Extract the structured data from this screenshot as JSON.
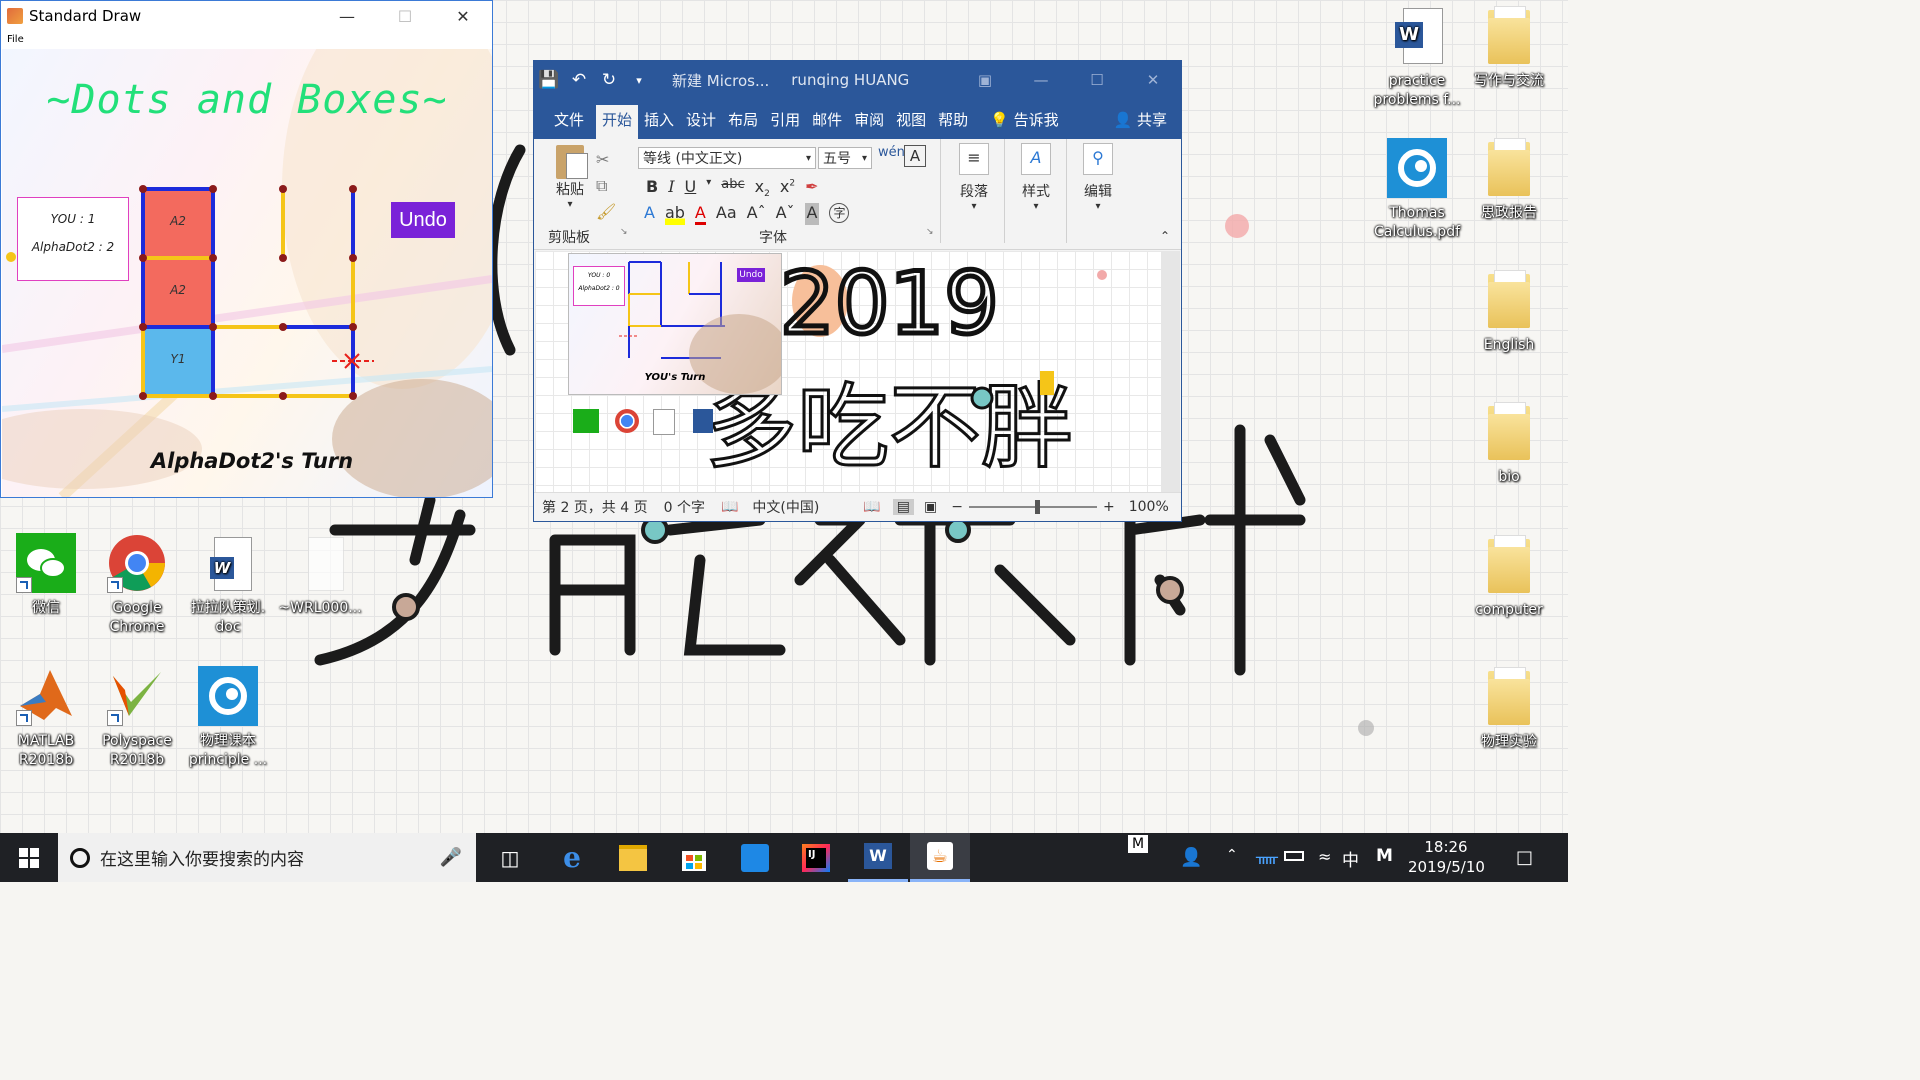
{
  "desktop": {
    "icons_left": [
      {
        "label": "微信"
      },
      {
        "label": "Google\nChrome"
      },
      {
        "label": "拉拉队策划.\ndoc"
      },
      {
        "label": "~WRL000..."
      },
      {
        "label": "MATLAB\nR2018b"
      },
      {
        "label": "Polyspace\nR2018b"
      },
      {
        "label": "物理课本\nprinciple ..."
      }
    ],
    "icons_right": [
      {
        "label": "practice\nproblems f..."
      },
      {
        "label": "写作与交流"
      },
      {
        "label": "Thomas\nCalculus.pdf"
      },
      {
        "label": "思政报告"
      },
      {
        "label": "English"
      },
      {
        "label": "bio"
      },
      {
        "label": "computer"
      },
      {
        "label": "物理实验"
      }
    ]
  },
  "stddraw": {
    "title": "Standard Draw",
    "menu_file": "File",
    "game_title": "~Dots and Boxes~",
    "score_you": "YOU : 1",
    "score_ai": "AlphaDot2 : 2",
    "undo_label": "Undo",
    "turn_text": "AlphaDot2's Turn",
    "box_labels": [
      "A2",
      "A2",
      "Y1"
    ]
  },
  "word": {
    "doc_title": "新建 Micros...",
    "user": "runqing HUANG",
    "tabs": [
      "文件",
      "开始",
      "插入",
      "设计",
      "布局",
      "引用",
      "邮件",
      "审阅",
      "视图",
      "帮助"
    ],
    "active_tab": "开始",
    "tell_me": "告诉我",
    "share": "共享",
    "paste_label": "粘贴",
    "clipboard_label": "剪贴板",
    "font_name": "等线 (中文正文)",
    "font_size": "五号",
    "font_group_label": "字体",
    "paragraph_label": "段落",
    "styles_label": "样式",
    "edit_label": "编辑",
    "page_big_text": "2019",
    "page_cn_text": "多吃不胖",
    "thumb_undo": "Undo",
    "thumb_you": "YOU : 0",
    "thumb_ai": "AlphaDot2 : 0",
    "thumb_turn": "YOU's Turn",
    "status_page": "第 2 页，共 4 页",
    "status_words": "0 个字",
    "status_lang": "中文(中国)",
    "zoom": "100%"
  },
  "taskbar": {
    "search_placeholder": "在这里输入你要搜索的内容",
    "time": "18:26",
    "date": "2019/5/10",
    "ime": "中",
    "ime2": "M"
  }
}
